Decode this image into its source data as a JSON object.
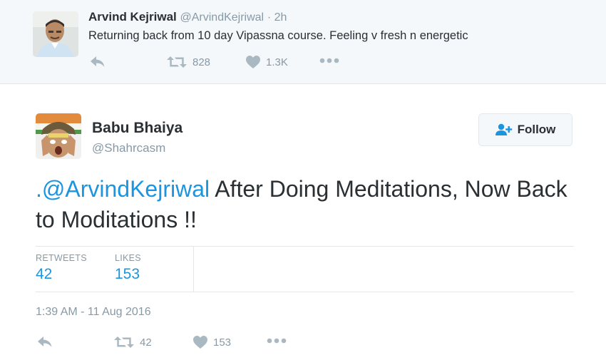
{
  "parent_tweet": {
    "author_name": "Arvind Kejriwal",
    "author_handle": "@ArvindKejriwal",
    "time_ago": "· 2h",
    "text": "Returning back from 10 day Vipassna course. Feeling v fresh n energetic",
    "retweet_count": "828",
    "like_count": "1.3K",
    "icons": [
      "reply-icon",
      "retweet-icon",
      "heart-icon",
      "more-icon"
    ]
  },
  "tweet": {
    "author_name": "Babu Bhaiya",
    "author_handle": "@Shahrcasm",
    "follow_label": "Follow",
    "mention": ".@ArvindKejriwal",
    "text_rest": " After Doing Meditations, Now Back to Moditations !!",
    "stats": {
      "retweets_label": "RETWEETS",
      "retweets_value": "42",
      "likes_label": "LIKES",
      "likes_value": "153"
    },
    "timestamp": "1:39 AM - 11 Aug 2016",
    "retweet_count": "42",
    "like_count": "153",
    "icons": [
      "reply-icon",
      "retweet-icon",
      "heart-icon",
      "more-icon"
    ]
  },
  "colors": {
    "link_blue": "#1b95e0",
    "muted_gray": "#8899a6",
    "icon_gray": "#aab8c2",
    "parent_background": "#f5f8fa"
  }
}
